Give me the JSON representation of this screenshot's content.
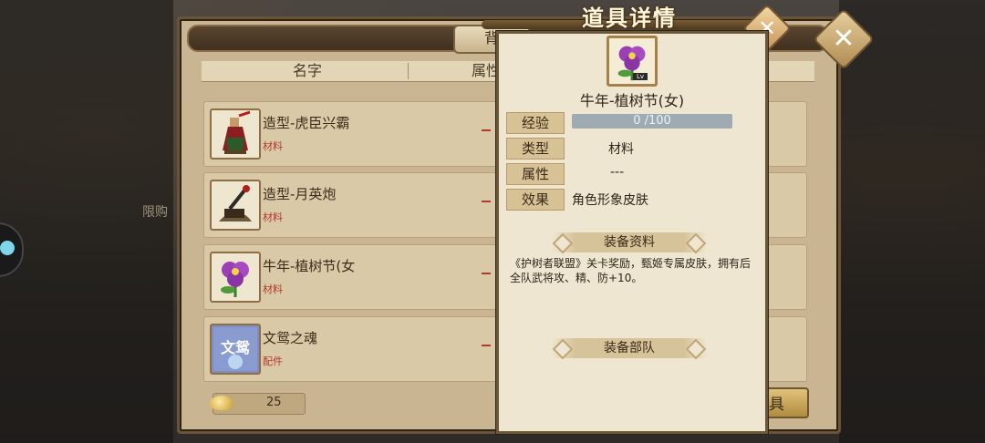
{
  "bag": {
    "tab_label": "背",
    "columns": {
      "name": "名字",
      "attr": "属性",
      "extra": ""
    },
    "items": [
      {
        "name": "造型-虎臣兴霸",
        "type": "材料",
        "icon": "warrior-figure-icon"
      },
      {
        "name": "造型-月英炮",
        "type": "材料",
        "icon": "catapult-icon"
      },
      {
        "name": "牛年-植树节(女",
        "type": "材料",
        "icon": "purple-flower-icon"
      },
      {
        "name": "文鸳之魂",
        "type": "配件",
        "icon": "wenyuan-soul-icon",
        "icon_text": "文鸳"
      }
    ],
    "gold": "25",
    "bottom_button": "具"
  },
  "background": {
    "side_text": "限购"
  },
  "detail": {
    "title": "道具详情",
    "icon": "purple-flower-icon",
    "icon_badge": "Lv",
    "name": "牛年-植树节(女)",
    "labels": {
      "exp": "经验",
      "type": "类型",
      "attr": "属性",
      "effect": "效果"
    },
    "exp_text": "0  /100",
    "exp_progress": 0,
    "type_value": "材料",
    "attr_value": "---",
    "effect_value": "角色形象皮肤",
    "section_info": "装备资料",
    "description": "《护树者联盟》关卡奖励，甄姬专属皮肤，拥有后全队武将攻、精、防+10。",
    "section_team": "装备部队"
  },
  "colors": {
    "panel": "#c9b591",
    "popup": "#efe6d1",
    "red_type": "#b3382c",
    "exp_bar": "#9eabb2"
  }
}
